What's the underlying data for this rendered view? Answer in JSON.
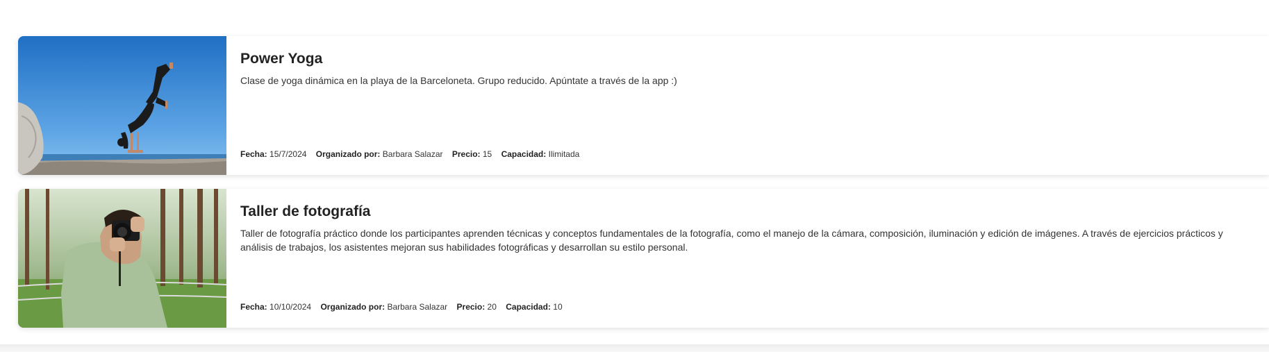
{
  "events": [
    {
      "title": "Power Yoga",
      "description": "Clase de yoga dinámica en la playa de la Barceloneta. Grupo reducido. Apúntate a través de la app :)",
      "image_alt": "Yoga pose on the beach",
      "meta": {
        "date_label": "Fecha:",
        "date": "15/7/2024",
        "organizer_label": "Organizado por:",
        "organizer": "Barbara Salazar",
        "price_label": "Precio:",
        "price": "15",
        "capacity_label": "Capacidad:",
        "capacity": "Ilimitada"
      }
    },
    {
      "title": "Taller de fotografía",
      "description": "Taller de fotografía práctico donde los participantes aprenden técnicas y conceptos fundamentales de la fotografía, como el manejo de la cámara, composición, iluminación y edición de imágenes. A través de ejercicios prácticos y análisis de trabajos, los asistentes mejoran sus habilidades fotográficas y desarrollan su estilo personal.",
      "image_alt": "Photographer with camera in a forest",
      "meta": {
        "date_label": "Fecha:",
        "date": "10/10/2024",
        "organizer_label": "Organizado por:",
        "organizer": "Barbara Salazar",
        "price_label": "Precio:",
        "price": "20",
        "capacity_label": "Capacidad:",
        "capacity": "10"
      }
    }
  ]
}
